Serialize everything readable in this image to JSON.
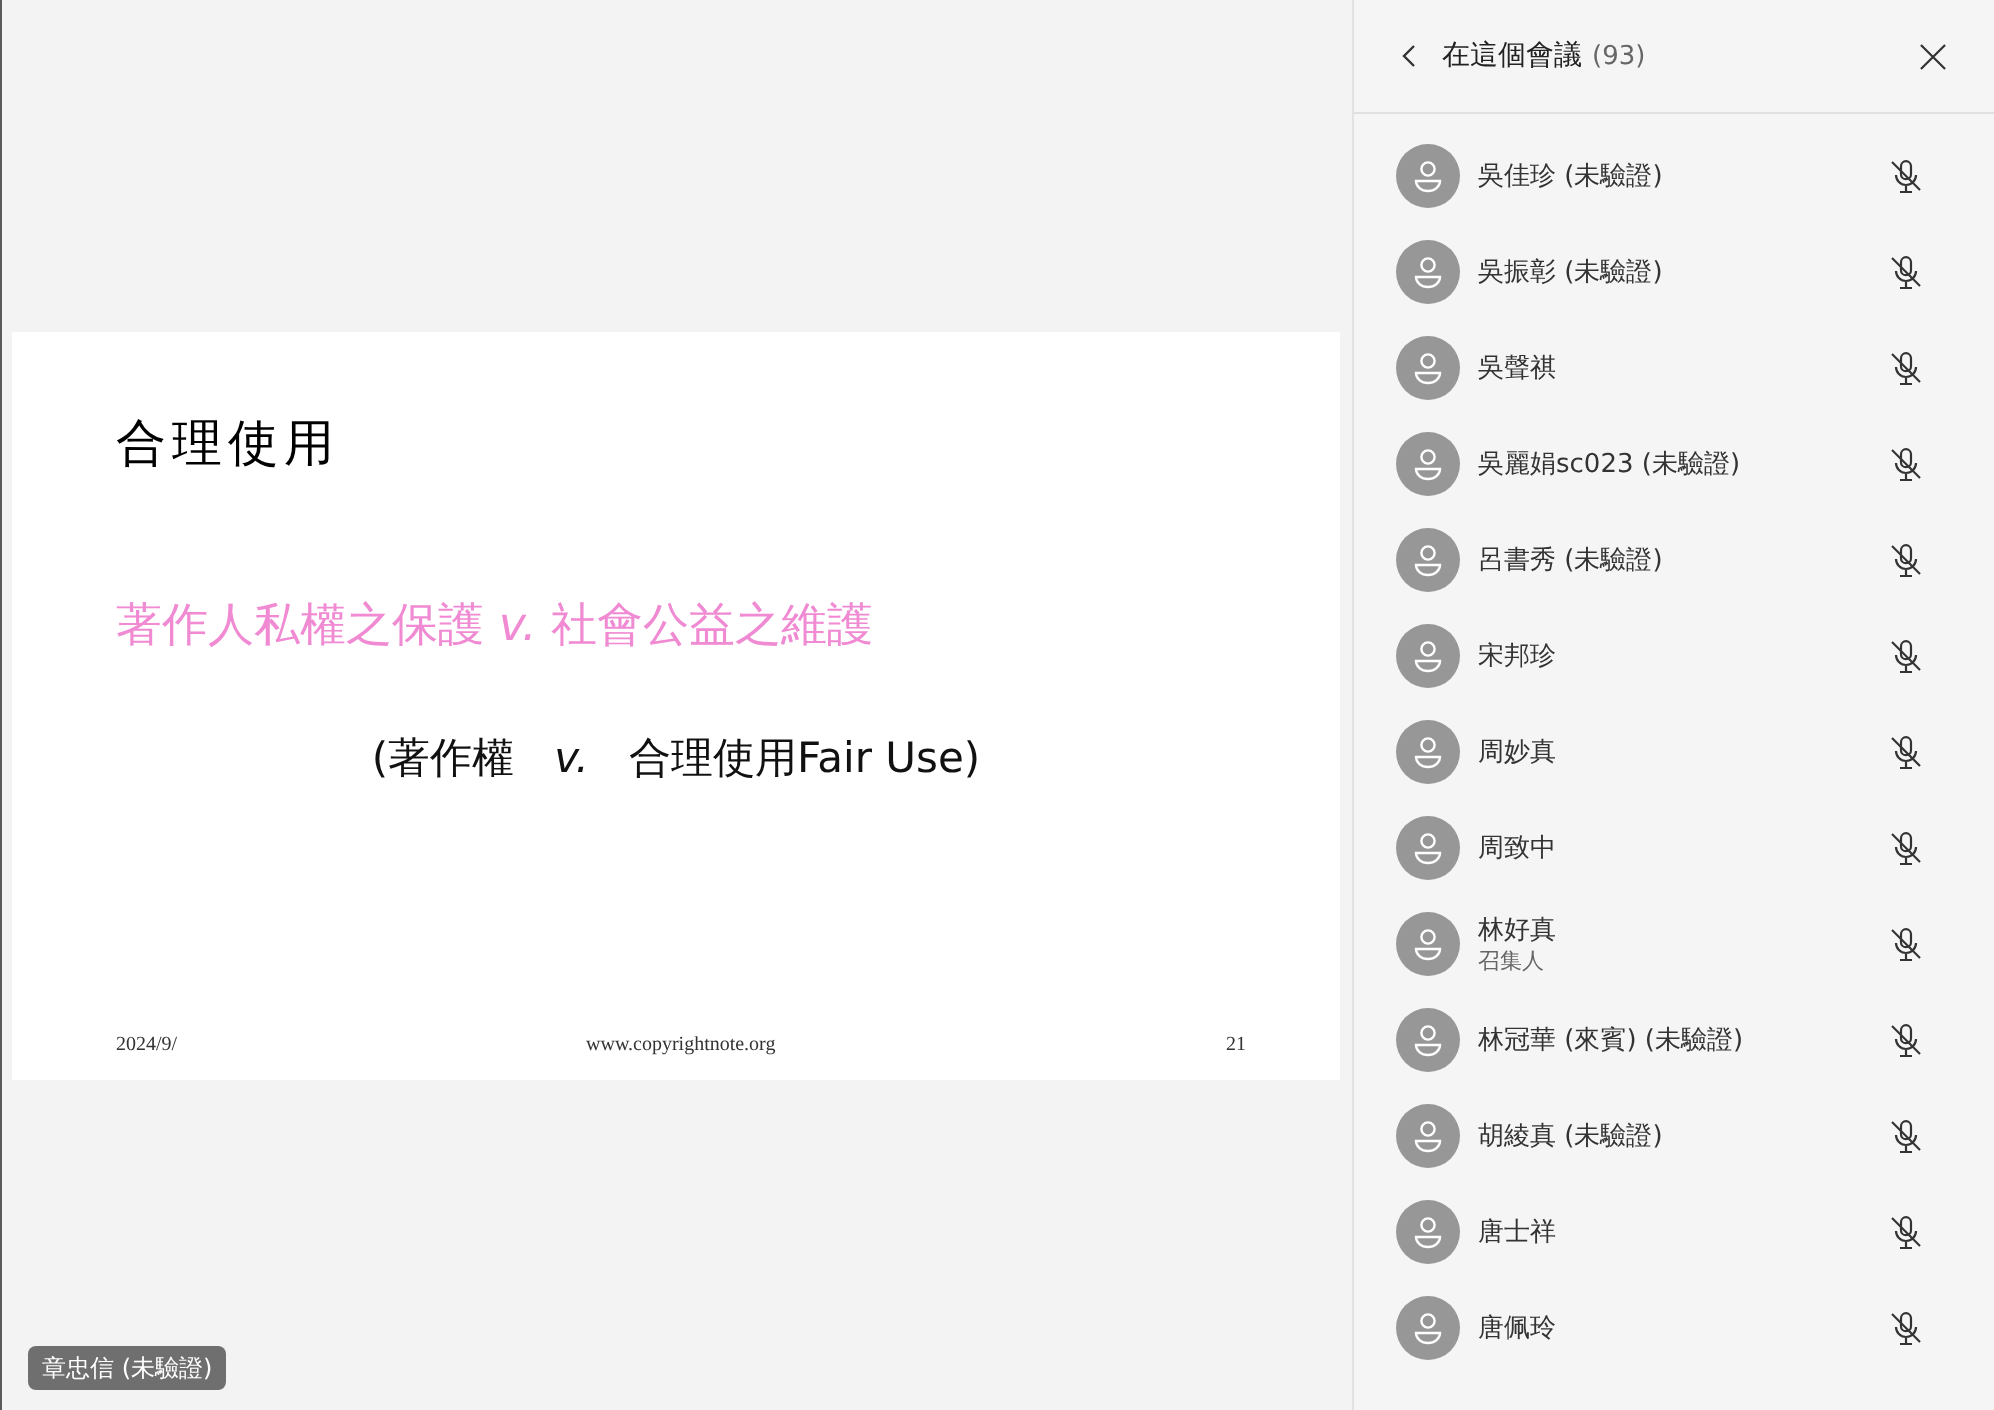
{
  "stage": {
    "slide": {
      "title": "合理使用",
      "subtitle": "著作人私權之保護 *v.* 社會公益之維護",
      "line": "(著作權   *v.*   合理使用Fair Use)",
      "footer": {
        "date": "2024/9/",
        "url": "www.copyrightnote.org",
        "page": "21"
      }
    },
    "speaker_tag": "章忠信 (未驗證)"
  },
  "panel": {
    "title": "在這個會議",
    "count": "(93)",
    "participants": [
      {
        "name": "吳佳珍 (未驗證)",
        "muted": true
      },
      {
        "name": "吳振彰 (未驗證)",
        "muted": true
      },
      {
        "name": "吳聲祺",
        "muted": true
      },
      {
        "name": "吳麗娟sc023 (未驗證)",
        "muted": true
      },
      {
        "name": "呂書秀 (未驗證)",
        "muted": true
      },
      {
        "name": "宋邦珍",
        "muted": true
      },
      {
        "name": "周妙真",
        "muted": true
      },
      {
        "name": "周致中",
        "muted": true
      },
      {
        "name": "林好真",
        "role": "召集人",
        "muted": true
      },
      {
        "name": "林冠華 (來賓) (未驗證)",
        "muted": true
      },
      {
        "name": "胡綾真 (未驗證)",
        "muted": true
      },
      {
        "name": "唐士祥",
        "muted": true
      },
      {
        "name": "唐佩玲",
        "muted": true
      }
    ]
  }
}
